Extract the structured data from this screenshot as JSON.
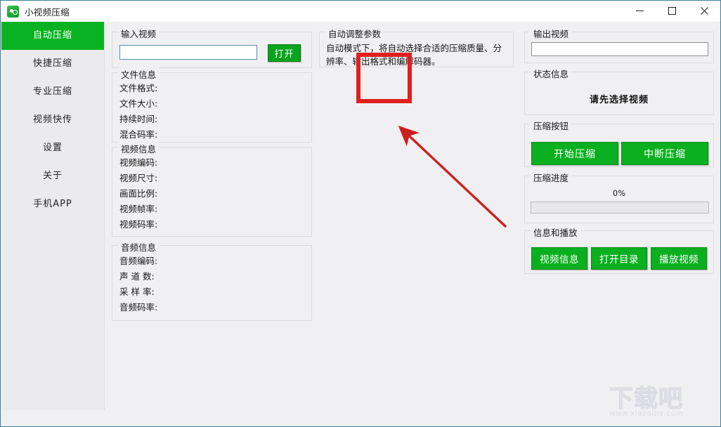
{
  "window": {
    "title": "小视频压缩",
    "icon": "app-logo-icon",
    "minimize_label": "—",
    "maximize_label": "□",
    "close_label": "✕"
  },
  "sidebar": {
    "items": [
      {
        "label": "自动压缩",
        "active": true
      },
      {
        "label": "快捷压缩",
        "active": false
      },
      {
        "label": "专业压缩",
        "active": false
      },
      {
        "label": "视频快传",
        "active": false
      },
      {
        "label": "设置",
        "active": false
      },
      {
        "label": "关于",
        "active": false
      },
      {
        "label": "手机APP",
        "active": false
      }
    ]
  },
  "input_video": {
    "legend": "输入视频",
    "path_value": "",
    "path_placeholder": "",
    "open_button": "打开"
  },
  "file_info": {
    "legend": "文件信息",
    "rows": [
      {
        "label": "文件格式:",
        "value": ""
      },
      {
        "label": "文件大小:",
        "value": ""
      },
      {
        "label": "持续时间:",
        "value": ""
      },
      {
        "label": "混合码率:",
        "value": ""
      }
    ]
  },
  "video_info": {
    "legend": "视频信息",
    "rows": [
      {
        "label": "视频编码:",
        "value": ""
      },
      {
        "label": "视频尺寸:",
        "value": ""
      },
      {
        "label": "画面比例:",
        "value": ""
      },
      {
        "label": "视频帧率:",
        "value": ""
      },
      {
        "label": "视频码率:",
        "value": ""
      }
    ]
  },
  "audio_info": {
    "legend": "音频信息",
    "rows": [
      {
        "label": "音频编码:",
        "value": ""
      },
      {
        "label": "声 道 数:",
        "value": ""
      },
      {
        "label": "采 样 率:",
        "value": ""
      },
      {
        "label": "音频码率:",
        "value": ""
      }
    ]
  },
  "auto_params": {
    "legend": "自动调整参数",
    "description": "自动模式下，将自动选择合适的压缩质量、分辨率、输出格式和编解码器。"
  },
  "output_video": {
    "legend": "输出视频",
    "path_value": "",
    "path_placeholder": ""
  },
  "status": {
    "legend": "状态信息",
    "message": "请先选择视频"
  },
  "compress_buttons": {
    "legend": "压缩按钮",
    "start_label": "开始压缩",
    "stop_label": "中断压缩"
  },
  "progress": {
    "legend": "压缩进度",
    "percent_text": "0%",
    "percent_value": 0
  },
  "info_play": {
    "legend": "信息和播放",
    "video_info_label": "视频信息",
    "open_dir_label": "打开目录",
    "play_video_label": "播放视频"
  },
  "annotations": {
    "highlight_color": "#e02020",
    "arrow_color": "#cc2020"
  },
  "watermark": {
    "text": "下载吧",
    "url": "www.xiazaiba.com"
  },
  "theme": {
    "accent_green": "#0ab01f",
    "sidebar_active_green": "#09b222",
    "window_bg": "#f0eff1",
    "sidebar_bg": "#ebeaec"
  }
}
